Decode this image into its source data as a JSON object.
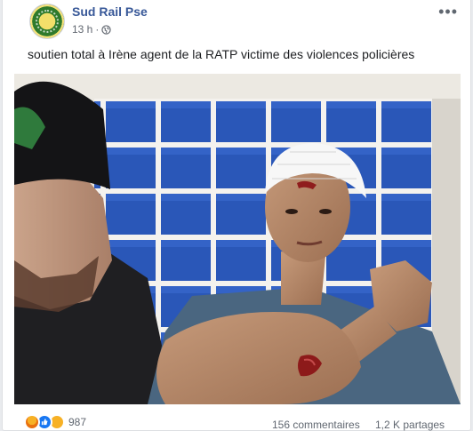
{
  "post": {
    "author": "Sud Rail Pse",
    "timestamp": "13 h",
    "separator": "·",
    "text": "soutien total à Irène agent de la RATP victime des violences policières",
    "more_icon": "ellipsis-icon",
    "privacy_icon": "globe-icon"
  },
  "photo": {
    "icon": "photo"
  },
  "footer": {
    "reactions": [
      "angry-reaction-icon",
      "like-reaction-icon",
      "sad-reaction-icon"
    ],
    "reaction_count": "987",
    "comments": "156 commentaires",
    "shares": "1,2 K partages"
  },
  "colors": {
    "link": "#385898",
    "meta": "#616770",
    "tile_blue": "#2a57b8"
  }
}
